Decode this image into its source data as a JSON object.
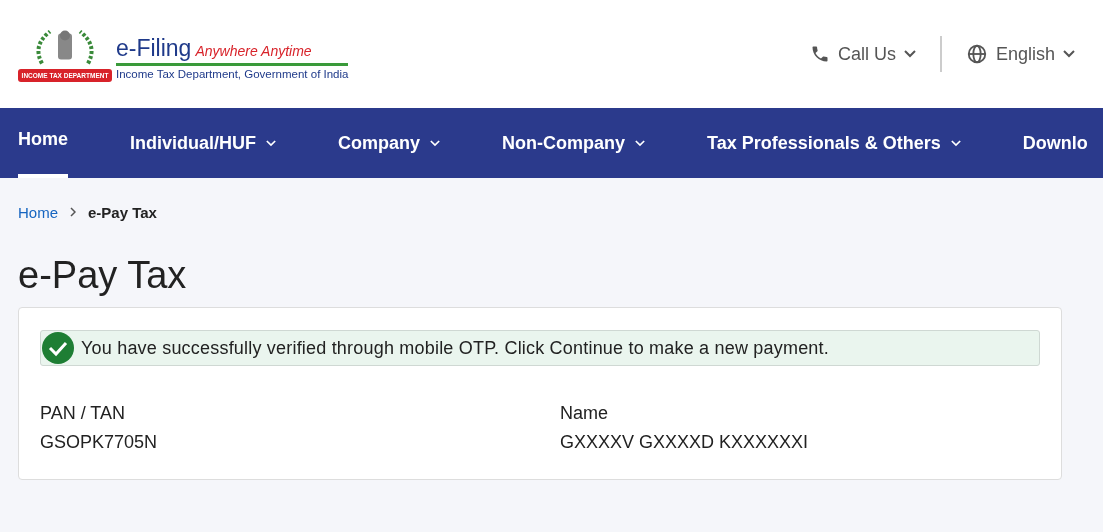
{
  "header": {
    "logo": {
      "ribbon": "INCOME TAX DEPARTMENT",
      "title": "e-Filing",
      "tagline": "Anywhere Anytime",
      "subtitle": "Income Tax Department, Government of India"
    },
    "call_us": {
      "label": "Call Us"
    },
    "language": {
      "label": "English"
    }
  },
  "nav": [
    {
      "label": "Home",
      "selected": true,
      "has_menu": false
    },
    {
      "label": "Individual/HUF",
      "selected": false,
      "has_menu": true
    },
    {
      "label": "Company",
      "selected": false,
      "has_menu": true
    },
    {
      "label": "Non-Company",
      "selected": false,
      "has_menu": true
    },
    {
      "label": "Tax Professionals & Others",
      "selected": false,
      "has_menu": true
    },
    {
      "label": "Downlo",
      "selected": false,
      "has_menu": false
    }
  ],
  "breadcrumb": [
    {
      "label": "Home",
      "kind": "link"
    },
    {
      "label": "e-Pay Tax",
      "kind": "current"
    }
  ],
  "page_title": "e-Pay Tax",
  "alert": {
    "kind": "success",
    "message": "You have successfully verified through mobile OTP. Click Continue to make a new payment."
  },
  "fields": [
    {
      "label": "PAN / TAN",
      "value": "GSOPK7705N"
    },
    {
      "label": "Name",
      "value": "GXXXXV GXXXXD KXXXXXXI"
    }
  ]
}
